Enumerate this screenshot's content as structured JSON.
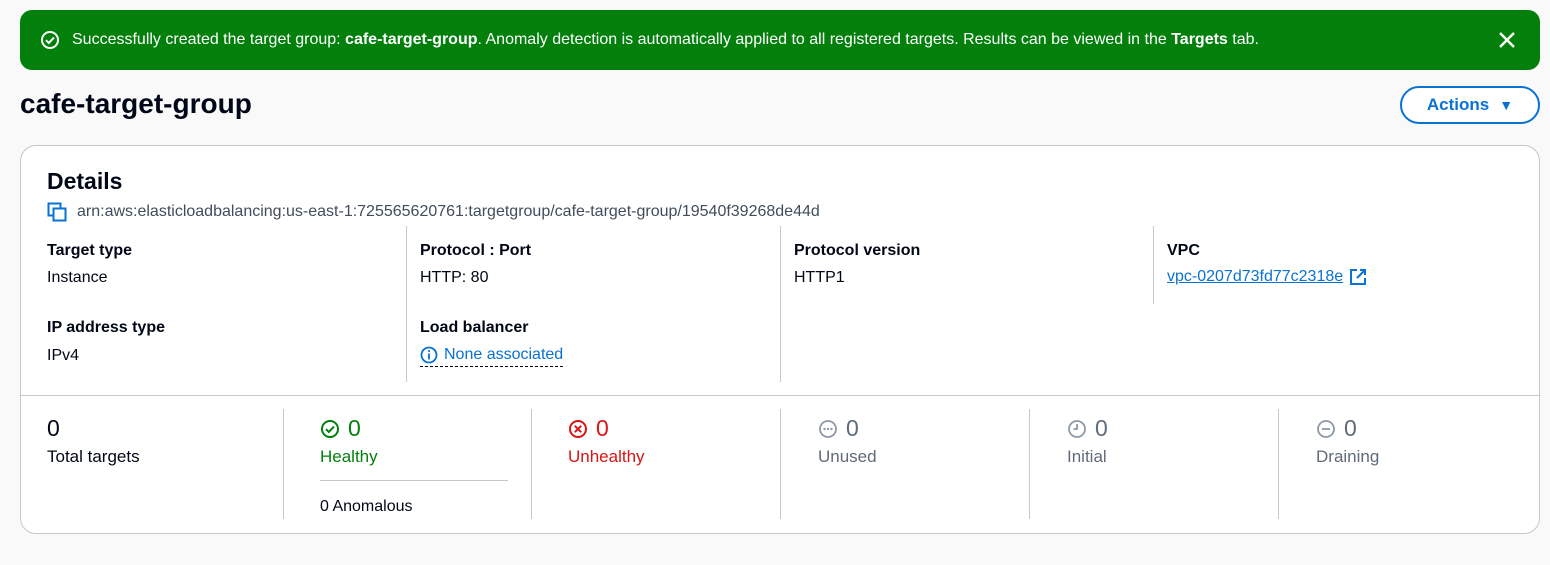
{
  "flash": {
    "prefix": "Successfully created the target group: ",
    "group_name": "cafe-target-group",
    "middle": ". Anomaly detection is automatically applied to all registered targets. Results can be viewed in the ",
    "tab_name": "Targets",
    "suffix": " tab."
  },
  "page": {
    "title": "cafe-target-group",
    "actions_label": "Actions"
  },
  "details": {
    "heading": "Details",
    "arn": "arn:aws:elasticloadbalancing:us-east-1:725565620761:targetgroup/cafe-target-group/19540f39268de44d",
    "target_type": {
      "label": "Target type",
      "value": "Instance"
    },
    "ip_address_type": {
      "label": "IP address type",
      "value": "IPv4"
    },
    "protocol_port": {
      "label": "Protocol : Port",
      "value": "HTTP: 80"
    },
    "load_balancer": {
      "label": "Load balancer",
      "value": "None associated"
    },
    "protocol_version": {
      "label": "Protocol version",
      "value": "HTTP1"
    },
    "vpc": {
      "label": "VPC",
      "value": "vpc-0207d73fd77c2318e"
    }
  },
  "stats": {
    "total": {
      "value": "0",
      "label": "Total targets"
    },
    "healthy": {
      "value": "0",
      "label": "Healthy",
      "anomalous": "0 Anomalous"
    },
    "unhealthy": {
      "value": "0",
      "label": "Unhealthy"
    },
    "unused": {
      "value": "0",
      "label": "Unused"
    },
    "initial": {
      "value": "0",
      "label": "Initial"
    },
    "draining": {
      "value": "0",
      "label": "Draining"
    }
  },
  "colors": {
    "success": "#037f0c",
    "error": "#d91515",
    "link": "#0972d3",
    "muted": "#5f6b7a"
  }
}
